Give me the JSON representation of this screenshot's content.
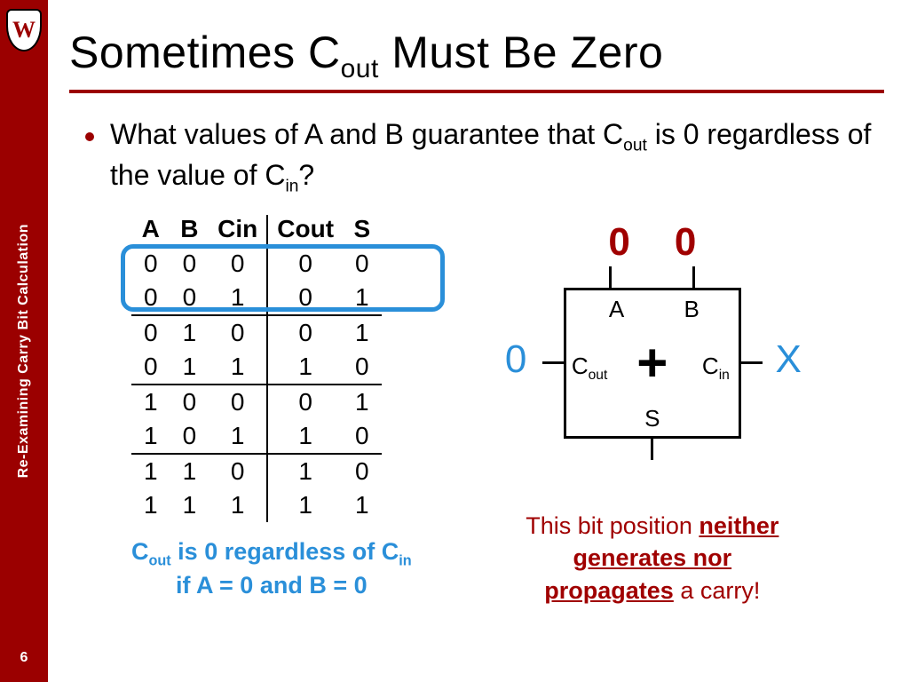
{
  "sidebar": {
    "crest_letter": "W",
    "vertical_label": "Re-Examining Carry Bit Calculation",
    "page_number": "6"
  },
  "title": {
    "pre": "Sometimes C",
    "sub": "out",
    "post": " Must Be Zero"
  },
  "bullet": {
    "t1": "What values of A and B guarantee that C",
    "t1_sub": "out",
    "t2": " is 0 regardless of the value of C",
    "t2_sub": "in",
    "t3": "?"
  },
  "table": {
    "headers": [
      "A",
      "B",
      "Cin",
      "Cout",
      "S"
    ],
    "rows": [
      [
        "0",
        "0",
        "0",
        "0",
        "0"
      ],
      [
        "0",
        "0",
        "1",
        "0",
        "1"
      ],
      [
        "0",
        "1",
        "0",
        "0",
        "1"
      ],
      [
        "0",
        "1",
        "1",
        "1",
        "0"
      ],
      [
        "1",
        "0",
        "0",
        "0",
        "1"
      ],
      [
        "1",
        "0",
        "1",
        "1",
        "0"
      ],
      [
        "1",
        "1",
        "0",
        "1",
        "0"
      ],
      [
        "1",
        "1",
        "1",
        "1",
        "1"
      ]
    ]
  },
  "bottom_note": {
    "l1a": "C",
    "l1a_sub": "out",
    "l1b": " is 0 regardless of C",
    "l1b_sub": "in",
    "l2": "if A = 0 and B = 0"
  },
  "diagram": {
    "top_A_val": "0",
    "top_B_val": "0",
    "lbl_A": "A",
    "lbl_B": "B",
    "lbl_Cout": "C",
    "lbl_Cout_sub": "out",
    "lbl_Cin": "C",
    "lbl_Cin_sub": "in",
    "lbl_S": "S",
    "plus": "+",
    "ext_left": "0",
    "ext_right": "X"
  },
  "carry_note": {
    "t1": "This bit position ",
    "u1": "neither",
    "u2": "generates nor",
    "u3": "propagates",
    "t2": " a carry!"
  }
}
